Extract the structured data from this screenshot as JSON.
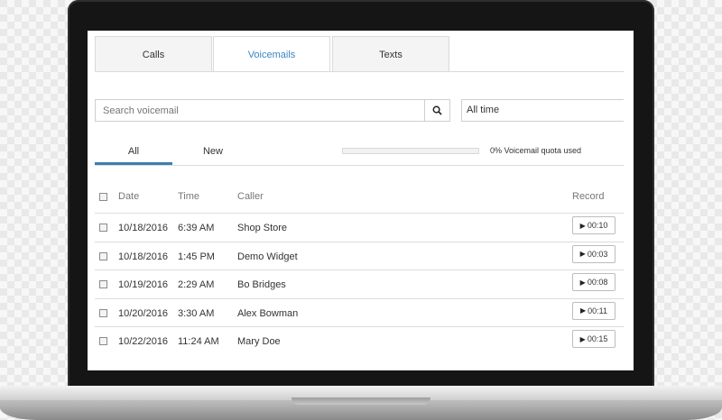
{
  "tabs": [
    {
      "label": "Calls",
      "active": false
    },
    {
      "label": "Voicemails",
      "active": true
    },
    {
      "label": "Texts",
      "active": false
    }
  ],
  "search": {
    "placeholder": "Search voicemail",
    "icon": "search-icon"
  },
  "period_select": {
    "value": "All time"
  },
  "filters": {
    "all_label": "All",
    "new_label": "New",
    "active": "All"
  },
  "quota": {
    "text": "0% Voicemail quota used",
    "percent_used": 0
  },
  "table": {
    "headers": {
      "date": "Date",
      "time": "Time",
      "caller": "Caller",
      "record": "Record"
    },
    "rows": [
      {
        "date": "10/18/2016",
        "time": "6:39 AM",
        "caller": "Shop Store",
        "duration": "00:10"
      },
      {
        "date": "10/18/2016",
        "time": "1:45 PM",
        "caller": "Demo Widget",
        "duration": "00:03"
      },
      {
        "date": "10/19/2016",
        "time": "2:29 AM",
        "caller": "Bo Bridges",
        "duration": "00:08"
      },
      {
        "date": "10/20/2016",
        "time": "3:30 AM",
        "caller": "Alex Bowman",
        "duration": "00:11"
      },
      {
        "date": "10/22/2016",
        "time": "11:24 AM",
        "caller": "Mary Doe",
        "duration": "00:15"
      }
    ]
  },
  "colors": {
    "accent": "#3a87c0",
    "tab_underline": "#3a7fb5",
    "bezel": "#151515"
  }
}
